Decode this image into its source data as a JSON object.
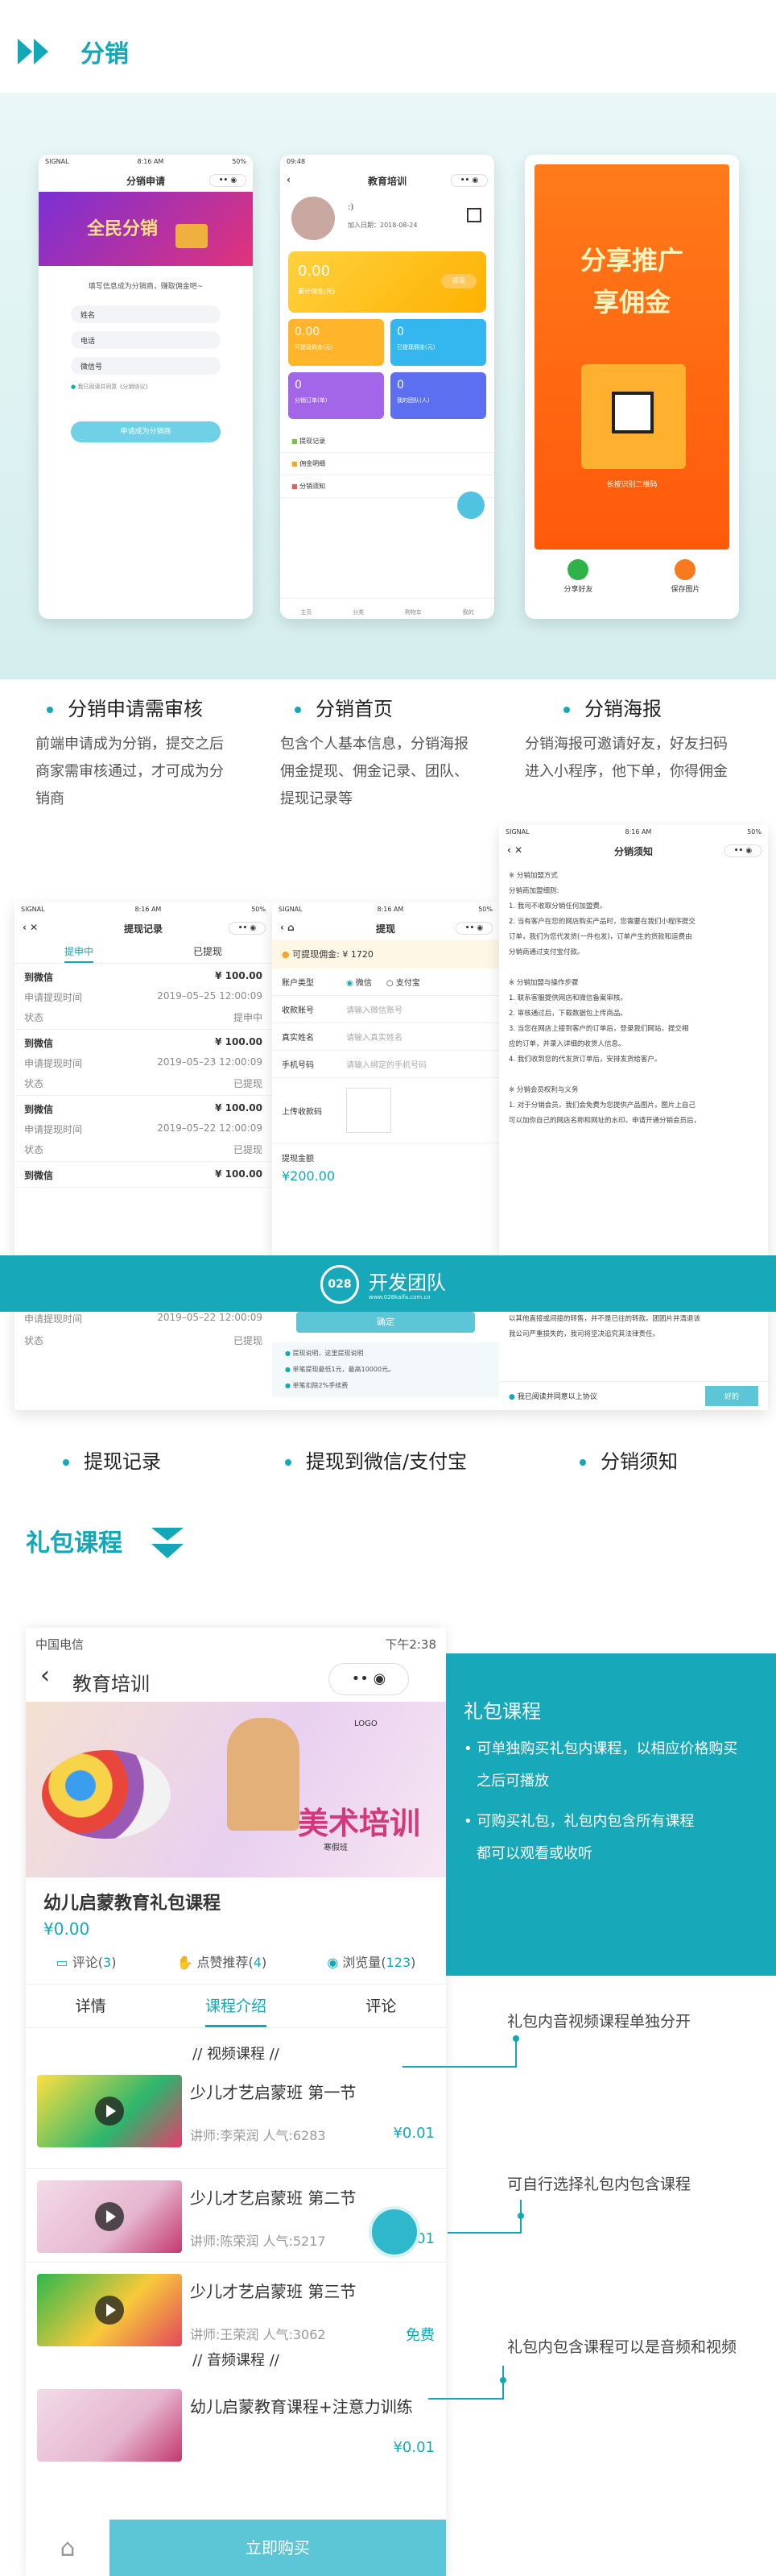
{
  "section1": {
    "title": "分销"
  },
  "phone1": {
    "status_signal": "SIGNAL",
    "status_time": "8:16 AM",
    "status_batt": "50%",
    "nav_title": "分销申请",
    "banner_text": "全民分销",
    "intro": "填写信息成为分销商，赚取佣金吧~",
    "fields": [
      "姓名",
      "电话",
      "微信号"
    ],
    "agree": "我已阅读并同意《分销协议》",
    "submit": "申请成为分销商"
  },
  "phone2": {
    "status_time": "09:48",
    "nav_title": "教育培训",
    "username": ":)",
    "join_date": "加入日期：2018-08-24",
    "cards": [
      {
        "value": "0.00",
        "label": "累计佣金(元)",
        "btn": "提现"
      },
      {
        "value": "0.00",
        "label": "可提现佣金(元)"
      },
      {
        "value": "0",
        "label": "已提现佣金(元)"
      },
      {
        "value": "0",
        "label": "分销订单(单)"
      },
      {
        "value": "0",
        "label": "我的团队(人)"
      }
    ],
    "menu": [
      "提现记录",
      "佣金明细",
      "分销须知"
    ],
    "tabs": [
      "主页",
      "分类",
      "购物车",
      "我的"
    ]
  },
  "phone3": {
    "poster_title_1": "分享推广",
    "poster_title_2": "享佣金",
    "qr_caption": "长按识别二维码",
    "actions": [
      "分享好友",
      "保存图片"
    ]
  },
  "features1": [
    {
      "title": "分销申请需审核",
      "desc": [
        "前端申请成为分销，提交之后",
        "商家需审核通过，才可成为分",
        "销商"
      ]
    },
    {
      "title": "分销首页",
      "desc": [
        "包含个人基本信息，分销海报",
        "佣金提现、佣金记录、团队、",
        "提现记录等"
      ]
    },
    {
      "title": "分销海报",
      "desc": [
        "分销海报可邀请好友，好友扫码",
        "进入小程序，他下单，你得佣金"
      ]
    }
  ],
  "phone4": {
    "status_signal": "SIGNAL",
    "status_time": "8:16 AM",
    "status_batt": "50%",
    "nav_title": "提现记录",
    "tabs": [
      "提申中",
      "已提现"
    ],
    "records": [
      {
        "title": "到微信",
        "amount": "¥ 100.00",
        "time_label": "申请提现时间",
        "time": "2019–05–25 12:00:09",
        "status_label": "状态",
        "status": "提申中"
      },
      {
        "title": "到微信",
        "amount": "¥ 100.00",
        "time_label": "申请提现时间",
        "time": "2019–05–23 12:00:09",
        "status_label": "状态",
        "status": "已提现"
      },
      {
        "title": "到微信",
        "amount": "¥ 100.00",
        "time_label": "申请提现时间",
        "time": "2019–05–22 12:00:09",
        "status_label": "状态",
        "status": "已提现"
      },
      {
        "title": "到微信",
        "amount": "¥ 100.00",
        "time_label": "申请提现时间",
        "time": "2019–05–22 12:00:09",
        "status_label": "状态",
        "status": "已提现"
      }
    ]
  },
  "phone5": {
    "status_signal": "SIGNAL",
    "status_time": "8:16 AM",
    "status_batt": "50%",
    "nav_title": "提现",
    "available_label": "可提现佣金:",
    "available_value": "¥ 1720",
    "rows": [
      {
        "label": "账户类型",
        "value": "微信",
        "value2": "支付宝"
      },
      {
        "label": "收款账号",
        "value": "请输入微信账号"
      },
      {
        "label": "真实姓名",
        "value": "请输入真实姓名"
      },
      {
        "label": "手机号码",
        "value": "请输入绑定的手机号码"
      }
    ],
    "upload_label": "上传收款码",
    "amount_label": "提现金额",
    "amount_value": "¥200.00",
    "confirm": "确定",
    "notes": [
      "提现说明，这里提现说明",
      "单笔提现最低1元，最高10000元。",
      "单笔扣除2%手续费"
    ]
  },
  "phone6": {
    "status_signal": "SIGNAL",
    "status_time": "8:16 AM",
    "status_batt": "50%",
    "nav_title": "分销须知",
    "lines": [
      "※ 分销加盟方式",
      "分销商加盟细则:",
      "1. 我司不收取分销任何加盟费。",
      "2. 当有客户在您的网店购买产品时，您需要在我们小程序提交",
      "订单，我们为您代发货(一件也发)，订单产生的货款和运费由",
      "分销商通过支付宝付款。",
      "",
      "※ 分销加盟与操作步骤",
      "1. 联系客服提供网店和微信备案审核。",
      "2. 审核通过后，下载数据包上传商品。",
      "3. 当您在网店上接到客户的订单后，登录我们网站，提交相",
      "应的订单，并录入详细的收货人信息。",
      "4. 我们收到您的代发货订单后，安排发货给客户。",
      "",
      "※ 分销会员权利与义务",
      "1. 对于分销会员，我们会免费为您提供产品图片，图片上自己",
      "可以加你自己的网店名称和网址的水印。申请开通分销会员后，",
      "",
      "",
      "以其他直接或间接的转售，并不是已往的转款。团团片并清退该",
      "我公司严重损失的，我司将坚决追究其法律责任。"
    ],
    "agree": "我已阅读并同意以上协议",
    "ok": "好的"
  },
  "overlay": {
    "logo_text": "028",
    "brand": "开发团队",
    "url": "www.028kaifa.com.cn"
  },
  "features2": [
    "提现记录",
    "提现到微信/支付宝",
    "分销须知"
  ],
  "section2": {
    "title": "礼包课程"
  },
  "phone7": {
    "carrier": "中国电信",
    "time": "下午2:38",
    "nav_title": "教育培训",
    "banner_text": "美术培训",
    "banner_sub": "寒假班",
    "banner_tag": "LOGO",
    "product_title": "幼儿启蒙教育礼包课程",
    "price": "¥0.00",
    "stats": [
      {
        "label": "评论(",
        "num": "3",
        "end": ")"
      },
      {
        "label": "点赞推荐(",
        "num": "4",
        "end": ")"
      },
      {
        "label": "浏览量(",
        "num": "123",
        "end": ")"
      }
    ],
    "tabs": [
      "详情",
      "课程介绍",
      "评论"
    ],
    "video_header": "//   视频课程   //",
    "courses": [
      {
        "title": "少儿才艺启蒙班 第一节",
        "meta": "讲师:李荣润 人气:6283",
        "price": "¥0.01"
      },
      {
        "title": "少儿才艺启蒙班 第二节",
        "meta": "讲师:陈荣润 人气:5217",
        "price": "¥0.01"
      },
      {
        "title": "少儿才艺启蒙班 第三节",
        "meta": "讲师:王荣润 人气:3062",
        "price": "免费"
      }
    ],
    "audio_header": "//   音频课程   //",
    "audio_course": {
      "title": "幼儿启蒙教育课程+注意力训练",
      "price": "¥0.01"
    },
    "buy": "立即购买"
  },
  "side_panel": {
    "title": "礼包课程",
    "bullets": [
      [
        "可单独购买礼包内课程，以相应价格购买",
        "之后可播放"
      ],
      [
        "可购买礼包，礼包内包含所有课程",
        "都可以观看或收听"
      ]
    ]
  },
  "notes": [
    "礼包内音视频课程单独分开",
    "可自行选择礼包内包含课程",
    "礼包内包含课程可以是音频和视频"
  ]
}
